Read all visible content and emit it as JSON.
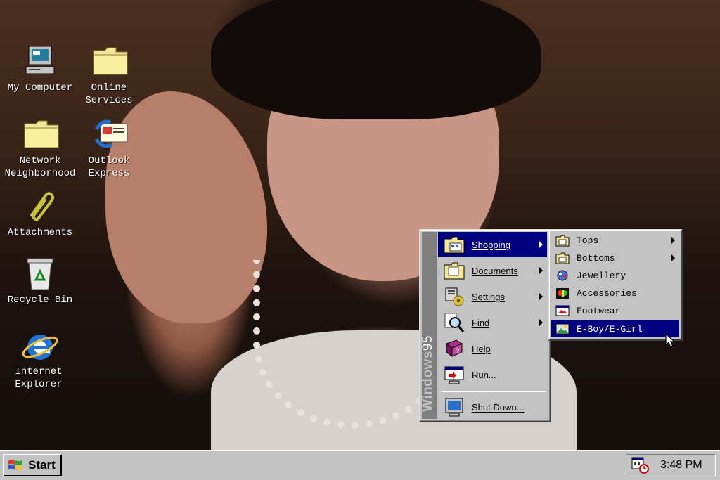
{
  "desktop": {
    "icons": [
      {
        "label": "My Computer",
        "icon": "computer-icon"
      },
      {
        "label": "Online Services",
        "icon": "folder-icon"
      },
      {
        "label": "Network Neighborhood",
        "icon": "folder-icon"
      },
      {
        "label": "Outlook Express",
        "icon": "outlook-express-icon"
      },
      {
        "label": "Attachments",
        "icon": "paperclip-icon"
      },
      {
        "label": "Recycle Bin",
        "icon": "recycle-bin-icon"
      },
      {
        "label": "Internet Explorer",
        "icon": "internet-explorer-icon"
      }
    ]
  },
  "start_menu": {
    "band_text_bold": "Windows",
    "band_text_light": "95",
    "items": [
      {
        "label": "Shopping",
        "icon": "shopping-folder-icon",
        "submenu": true,
        "active": true
      },
      {
        "label": "Documents",
        "icon": "documents-folder-icon",
        "submenu": true
      },
      {
        "label": "Settings",
        "icon": "settings-icon",
        "submenu": true
      },
      {
        "label": "Find",
        "icon": "find-icon",
        "submenu": true
      },
      {
        "label": "Help",
        "icon": "help-book-icon",
        "submenu": false
      },
      {
        "label": "Run...",
        "icon": "run-icon",
        "submenu": false
      },
      {
        "label": "Shut Down...",
        "icon": "shut-down-icon",
        "submenu": false
      }
    ]
  },
  "shopping_submenu": {
    "items": [
      {
        "label": "Tops",
        "icon": "folder-icon",
        "submenu": true
      },
      {
        "label": "Bottoms",
        "icon": "folder-icon",
        "submenu": true
      },
      {
        "label": "Jewellery",
        "icon": "jewellery-icon",
        "submenu": false
      },
      {
        "label": "Accessories",
        "icon": "accessories-icon",
        "submenu": false
      },
      {
        "label": "Footwear",
        "icon": "footwear-icon",
        "submenu": false
      },
      {
        "label": "E-Boy/E-Girl",
        "icon": "image-icon",
        "submenu": false,
        "active": true
      }
    ]
  },
  "taskbar": {
    "start_label": "Start",
    "clock": "3:48 PM",
    "tray_icon": "scheduler-icon"
  },
  "colors": {
    "window_gray": "#c3c3c3",
    "highlight": "#000080",
    "band_gray": "#808080"
  }
}
